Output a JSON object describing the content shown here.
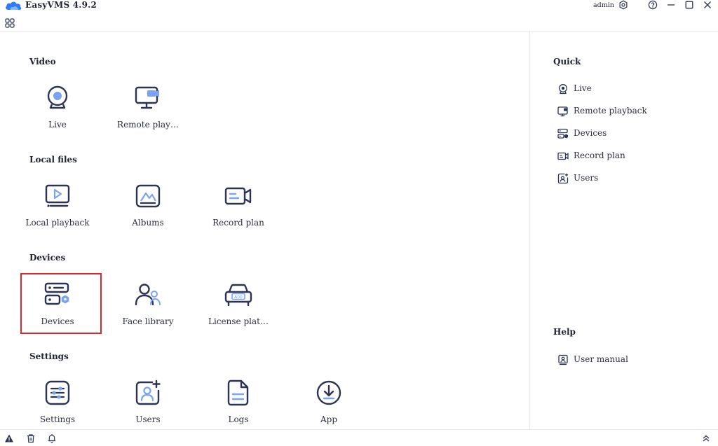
{
  "app": {
    "title": "EasyVMS 4.9.2",
    "user": "admin"
  },
  "colors": {
    "icon_dark": "#2d3352",
    "icon_accent": "#7aa3f5",
    "highlight": "#e0262c",
    "brand": "#2f7cf6"
  },
  "sections": {
    "video": {
      "title": "Video",
      "items": [
        {
          "label": "Live",
          "icon": "webcam-icon"
        },
        {
          "label": "Remote play…",
          "icon": "remote-playback-icon"
        }
      ]
    },
    "local_files": {
      "title": "Local files",
      "items": [
        {
          "label": "Local playback",
          "icon": "local-playback-icon"
        },
        {
          "label": "Albums",
          "icon": "albums-icon"
        },
        {
          "label": "Record plan",
          "icon": "record-plan-icon"
        }
      ]
    },
    "devices": {
      "title": "Devices",
      "items": [
        {
          "label": "Devices",
          "icon": "devices-icon"
        },
        {
          "label": "Face library",
          "icon": "face-library-icon"
        },
        {
          "label": "License plat…",
          "icon": "license-plate-icon"
        }
      ]
    },
    "settings": {
      "title": "Settings",
      "items": [
        {
          "label": "Settings",
          "icon": "settings-sliders-icon"
        },
        {
          "label": "Users",
          "icon": "add-user-icon"
        },
        {
          "label": "Logs",
          "icon": "logs-icon"
        },
        {
          "label": "App",
          "icon": "download-app-icon"
        }
      ]
    }
  },
  "quick": {
    "title": "Quick",
    "items": [
      {
        "label": "Live",
        "icon": "webcam-icon"
      },
      {
        "label": "Remote playback",
        "icon": "remote-playback-icon"
      },
      {
        "label": "Devices",
        "icon": "devices-icon"
      },
      {
        "label": "Record plan",
        "icon": "record-plan-icon"
      },
      {
        "label": "Users",
        "icon": "users-icon"
      }
    ]
  },
  "help": {
    "title": "Help",
    "items": [
      {
        "label": "User manual",
        "icon": "user-manual-icon"
      }
    ]
  }
}
